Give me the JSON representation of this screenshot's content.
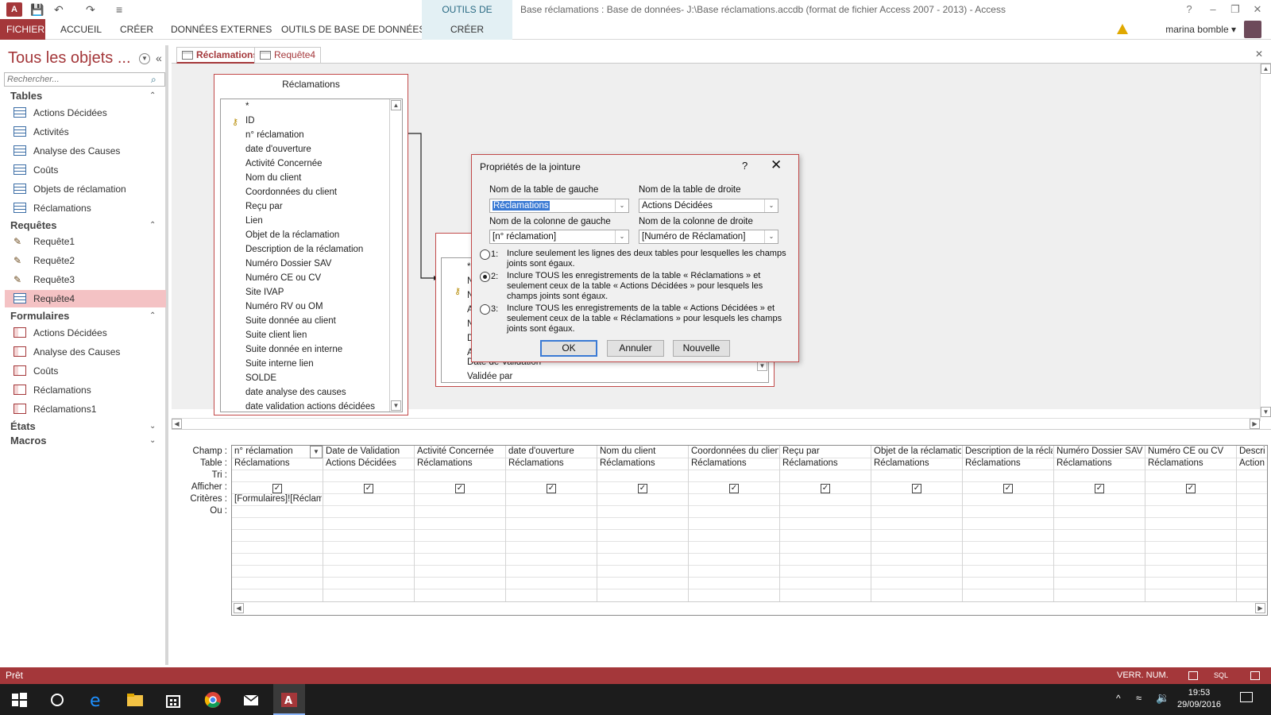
{
  "titlebar": {
    "logo": "A",
    "qat_save": "💾",
    "qat_undo": "↶",
    "qat_redo": "↷",
    "qat_customize": "≡",
    "context_tab": "OUTILS DE REQUÊTE",
    "title": "Base réclamations : Base de données- J:\\Base réclamations.accdb (format de fichier Access 2007 - 2013) - Access",
    "help": "?",
    "minimize": "–",
    "restore": "❐",
    "close": "✕"
  },
  "ribbon": {
    "tabs": [
      "FICHIER",
      "ACCUEIL",
      "CRÉER",
      "DONNÉES EXTERNES",
      "OUTILS DE BASE DE DONNÉES"
    ],
    "context_tab": "CRÉER",
    "user": "marina bomble ▾"
  },
  "nav": {
    "title": "Tous les objets ...",
    "dropdown": "▼",
    "collapse": "«",
    "search_placeholder": "Rechercher...",
    "search_icon": "⌕",
    "groups": {
      "tables": "Tables",
      "requetes": "Requêtes",
      "formulaires": "Formulaires",
      "etats": "États",
      "macros": "Macros"
    },
    "chevron_up": "⌃",
    "chevron_down": "⌄",
    "tables": [
      "Actions Décidées",
      "Activités",
      "Analyse des Causes",
      "Coûts",
      "Objets de réclamation",
      "Réclamations"
    ],
    "requetes": [
      "Requête1",
      "Requête2",
      "Requête3",
      "Requête4"
    ],
    "formulaires": [
      "Actions Décidées",
      "Analyse des Causes",
      "Coûts",
      "Réclamations",
      "Réclamations1"
    ]
  },
  "doctabs": {
    "tab1": "Réclamations",
    "tab2": "Requête4",
    "close": "✕"
  },
  "table_reclamations": {
    "title": "Réclamations",
    "fields": [
      "*",
      "ID",
      "n° réclamation",
      "date d'ouverture",
      "Activité Concernée",
      "Nom du client",
      "Coordonnées du client",
      "Reçu par",
      "Lien",
      "Objet de la réclamation",
      "Description de la réclamation",
      "Numéro Dossier SAV",
      "Numéro CE ou CV",
      "Site IVAP",
      "Numéro RV ou OM",
      "Suite donnée au client",
      "Suite client lien",
      "Suite donnée en interne",
      "Suite interne lien",
      "SOLDE",
      "date analyse des causes",
      "date validation actions décidées"
    ]
  },
  "table_actions": {
    "fields": [
      "*",
      "N",
      "N",
      "A",
      "N",
      "D",
      "A",
      "Date de Validation",
      "Validée par"
    ]
  },
  "qbe": {
    "row_labels": [
      "Champ :",
      "Table :",
      "Tri :",
      "Afficher :",
      "Critères :",
      "Ou :"
    ],
    "check": "✓",
    "columns": [
      {
        "field": "n° réclamation",
        "table": "Réclamations",
        "criteria": "[Formulaires]![Réclamations]"
      },
      {
        "field": "Date de Validation",
        "table": "Actions Décidées",
        "criteria": ""
      },
      {
        "field": "Activité Concernée",
        "table": "Réclamations",
        "criteria": ""
      },
      {
        "field": "date d'ouverture",
        "table": "Réclamations",
        "criteria": ""
      },
      {
        "field": "Nom du client",
        "table": "Réclamations",
        "criteria": ""
      },
      {
        "field": "Coordonnées du client",
        "table": "Réclamations",
        "criteria": ""
      },
      {
        "field": "Reçu par",
        "table": "Réclamations",
        "criteria": ""
      },
      {
        "field": "Objet de la réclamation",
        "table": "Réclamations",
        "criteria": ""
      },
      {
        "field": "Description de la réclamation",
        "table": "Réclamations",
        "criteria": ""
      },
      {
        "field": "Numéro Dossier SAV",
        "table": "Réclamations",
        "criteria": ""
      },
      {
        "field": "Numéro CE ou CV",
        "table": "Réclamations",
        "criteria": ""
      },
      {
        "field": "Descri",
        "table": "Action",
        "criteria": ""
      }
    ]
  },
  "dialog": {
    "title": "Propriétés de la jointure",
    "help": "?",
    "close": "✕",
    "left_table_label": "Nom de la table de gauche",
    "left_table_value": "Réclamations",
    "right_table_label": "Nom de la table de droite",
    "right_table_value": "Actions Décidées",
    "left_col_label": "Nom de la colonne de gauche",
    "left_col_value": "[n° réclamation]",
    "right_col_label": "Nom de la colonne de droite",
    "right_col_value": "[Numéro de Réclamation]",
    "options": [
      {
        "num": "1:",
        "text": "Inclure seulement les lignes des deux tables pour lesquelles les champs joints sont égaux.",
        "selected": false
      },
      {
        "num": "2:",
        "text": "Inclure TOUS les enregistrements de la table « Réclamations » et seulement ceux de la table « Actions Décidées » pour lesquels les champs joints sont égaux.",
        "selected": true
      },
      {
        "num": "3:",
        "text": "Inclure TOUS les enregistrements de la table « Actions Décidées » et seulement ceux de la table « Réclamations » pour lesquels les champs joints sont égaux.",
        "selected": false
      }
    ],
    "ok": "OK",
    "cancel": "Annuler",
    "new": "Nouvelle",
    "arrow": "⌄"
  },
  "status": {
    "left": "Prêt",
    "right": "VERR. NUM.",
    "sql": "SQL"
  },
  "taskbar": {
    "time": "19:53",
    "date": "29/09/2016"
  },
  "colors": {
    "accent": "#a4373a",
    "context": "#e3f0f4",
    "selected_nav": "#f4c2c4"
  }
}
